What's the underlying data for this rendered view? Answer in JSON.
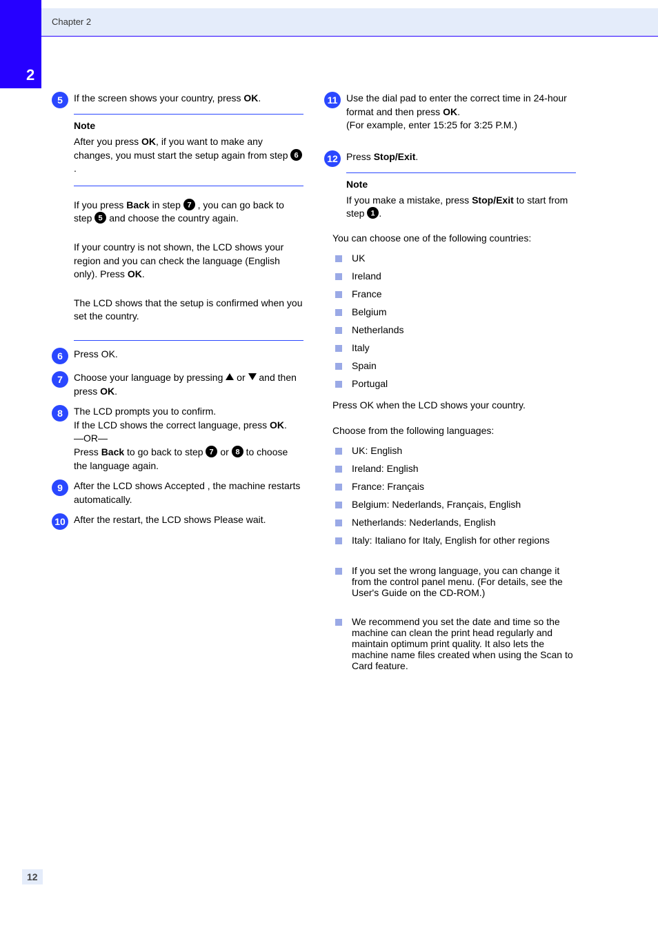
{
  "header": {
    "chapter_number": "2",
    "chapter_title": "Chapter 2"
  },
  "footer": {
    "page_number": "12"
  },
  "left": {
    "s5": {
      "num": "5",
      "text_a": "If the screen shows your country, press ",
      "ok": "OK",
      "text_b": "."
    },
    "note1": {
      "title": "Note",
      "body_a": "After you press ",
      "ok": "OK",
      "body_b": ", if you want to make any changes, you must start the setup again from step ",
      "dot": "6",
      "body_c": "."
    },
    "note2": {
      "body_a": "If you press ",
      "back": "Back",
      "body_b": " in step ",
      "d7": "7",
      "body_c": ", you can go back to step ",
      "d5": "5",
      "body_d": " and choose the country again."
    },
    "note3": {
      "body_a": "If your country is not shown, the LCD shows your region and you can check the language (English only). Press ",
      "ok": "OK",
      "body_b": "."
    },
    "note4": {
      "body": "The LCD shows that the setup is confirmed when you set the country."
    },
    "s6": {
      "num": "6",
      "text": "Press OK."
    },
    "s7": {
      "num": "7",
      "text_a": "Choose your language by pressing ",
      "or": " or ",
      "text_b": " and then press ",
      "ok": "OK",
      "text_c": "."
    },
    "s8": {
      "num": "8",
      "line1_a": "The LCD prompts you to confirm.",
      "line2_a": "If the LCD shows the correct language, press ",
      "ok": "OK",
      "line2_b": ".",
      "or1": "—OR—",
      "line3_a": "Press ",
      "back": "Back",
      "line3_b": " to go back to step ",
      "d7": "7",
      "line3_c": " or ",
      "d8": "8",
      "line3_d": " to choose the language again."
    },
    "s9": {
      "num": "9",
      "text_a": "After the LCD shows ",
      "accepted": "Accepted",
      "text_b": ", the machine restarts automatically."
    },
    "s10": {
      "num": "10",
      "text": "After the restart, the LCD shows Please wait."
    }
  },
  "right": {
    "s11": {
      "num": "11",
      "line1_a": "Use the dial pad to enter the correct time in 24-hour format and then press ",
      "ok": "OK",
      "line2": "(For example, enter 15:25 for 3:25 P.M.)"
    },
    "s12": {
      "num": "12",
      "text_a": "Press ",
      "stop": "Stop/Exit",
      "text_b": "."
    },
    "note1": {
      "title": "Note",
      "body_a": "If you make a mistake, press ",
      "stop": "Stop/Exit",
      "body_b": " to start from step ",
      "start_dot": "1",
      "body_c": "."
    },
    "list_a_title": "You can choose one of the following countries:",
    "list_a_items": [
      "UK",
      "Ireland",
      "France",
      "Belgium",
      "Netherlands",
      "Italy",
      "Spain",
      "Portugal"
    ],
    "list_a_tail": "Press OK when the LCD shows your country.",
    "list_b_title": "Choose from the following languages:",
    "list_b_items": [
      "UK: English",
      "Ireland: English",
      "France: Français",
      "Belgium: Nederlands, Français, English",
      "Netherlands: Nederlands, English",
      "Italy: Italiano for Italy, English for other regions"
    ],
    "list_c": [
      "If you set the wrong language, you can change it from the control panel menu. (For details, see the User's Guide on the CD-ROM.)",
      "We recommend you set the date and time so the machine can clean the print head regularly and maintain optimum print quality. It also lets the machine name files created when using the Scan to Card feature."
    ]
  }
}
